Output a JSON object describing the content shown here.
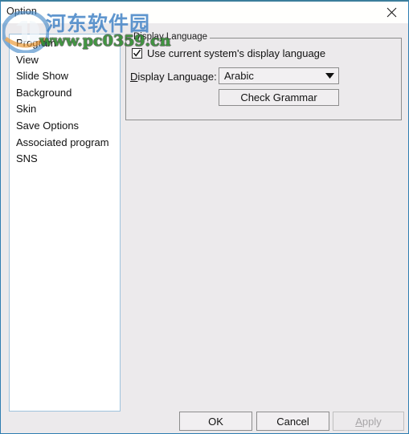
{
  "window": {
    "title": "Option",
    "close_icon": "close-icon"
  },
  "sidebar": {
    "items": [
      {
        "label": "Program"
      },
      {
        "label": "View"
      },
      {
        "label": "Slide Show"
      },
      {
        "label": "Background"
      },
      {
        "label": "Skin"
      },
      {
        "label": "Save Options"
      },
      {
        "label": "Associated program"
      },
      {
        "label": "SNS"
      }
    ]
  },
  "groupbox": {
    "legend": "Display Language",
    "checkbox": {
      "label": "Use current system's display language",
      "checked": true,
      "icon": "checkmark-icon"
    },
    "language_label": "Display Language:",
    "language_value": "Arabic",
    "language_options": [
      "Arabic"
    ],
    "dropdown_icon": "chevron-down-icon",
    "check_grammar_label": "Check Grammar"
  },
  "footer": {
    "ok_label": "OK",
    "cancel_label": "Cancel",
    "apply_label": "Apply",
    "apply_enabled": false
  },
  "watermark": {
    "site_name": "河东软件园",
    "url": "www.pc0359.cn",
    "logo_icon": "site-logo-icon",
    "colors": {
      "site_name": "#3d7fc4",
      "url": "#2e8b2e",
      "window_border": "#2f7eb1"
    }
  }
}
